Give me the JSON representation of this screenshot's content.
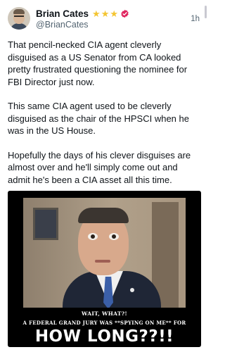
{
  "author": {
    "display_name": "Brian Cates",
    "handle": "@BrianCates",
    "badges": [
      "star-icon",
      "star-icon",
      "star-icon",
      "verified-icon"
    ],
    "colors": {
      "star": "#f4c531",
      "verified": "#e0245e"
    }
  },
  "post": {
    "time": "1h",
    "paragraphs": [
      "That pencil-necked CIA agent cleverly disguised as a US Senator from CA looked pretty frustrated questioning the nominee for FBI Director just now.",
      "This same CIA agent used to be cleverly disguised as the chair of the HPSCI when he was in the US House.",
      "Hopefully the days of his clever disguises are almost over and he'll simply come out and admit he's been a CIA asset all this time."
    ]
  },
  "media": {
    "caption_line1": "WAIT, WHAT?!",
    "caption_line2": "A FEDERAL GRAND JURY WAS **SPYING ON ME** FOR",
    "caption_big": "HOW LONG??!!"
  }
}
